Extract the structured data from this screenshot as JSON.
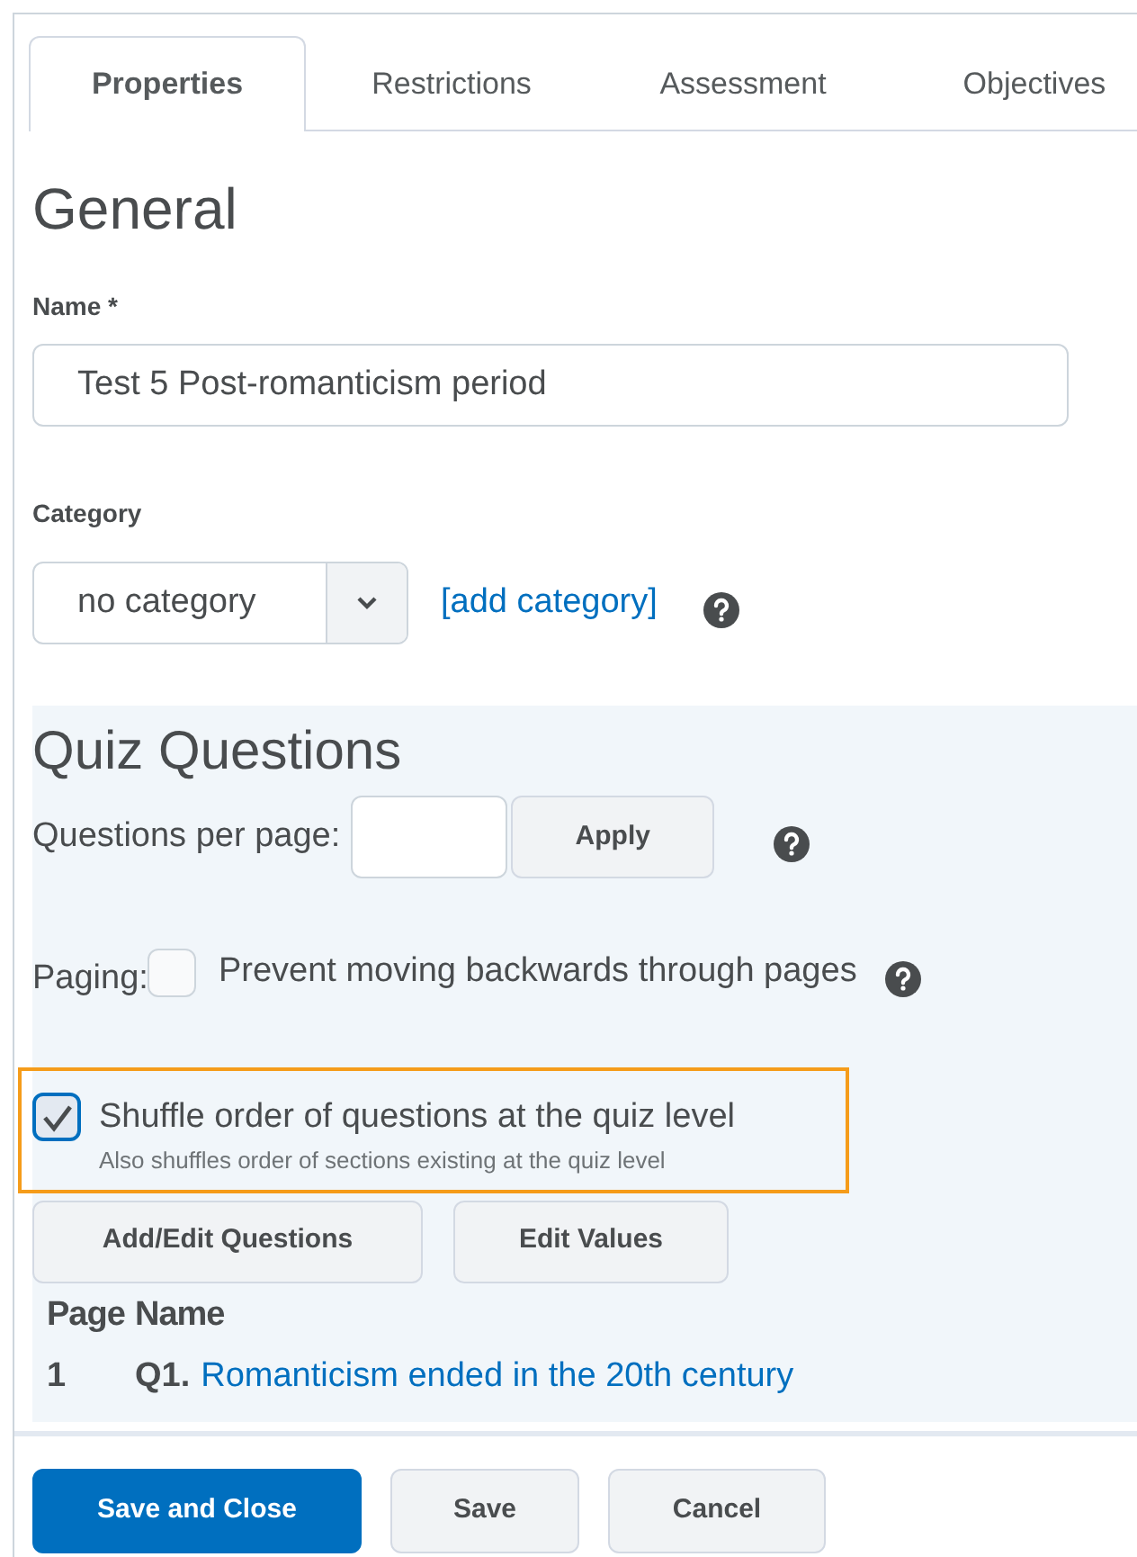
{
  "tabs": [
    {
      "label": "Properties",
      "selected": true
    },
    {
      "label": "Restrictions",
      "selected": false
    },
    {
      "label": "Assessment",
      "selected": false
    },
    {
      "label": "Objectives",
      "selected": false
    }
  ],
  "general": {
    "heading": "General",
    "name_label": "Name",
    "required_mark": "*",
    "name_value": "Test 5 Post-romanticism period",
    "category_label": "Category",
    "category_value": "no category",
    "add_category_link": "[add category]"
  },
  "quiz_questions": {
    "heading": "Quiz Questions",
    "questions_per_page_label": "Questions per page:",
    "apply_button": "Apply",
    "paging_label": "Paging:",
    "paging_option": {
      "label": "Prevent moving backwards through pages",
      "checked": false
    },
    "shuffle_option": {
      "label": "Shuffle order of questions at the quiz level",
      "description": "Also shuffles order of sections existing at the quiz level",
      "checked": true,
      "highlighted": true
    },
    "buttons": [
      "Add/Edit Questions",
      "Edit Values"
    ],
    "table": {
      "columns": [
        "Page",
        "Name"
      ],
      "rows": [
        {
          "page": "1",
          "number": "Q1.",
          "title": "Romanticism ended in the 20th century"
        }
      ]
    }
  },
  "footer_buttons": [
    {
      "label": "Save and Close",
      "kind": "primary"
    },
    {
      "label": "Save",
      "kind": "secondary"
    },
    {
      "label": "Cancel",
      "kind": "secondary"
    }
  ]
}
